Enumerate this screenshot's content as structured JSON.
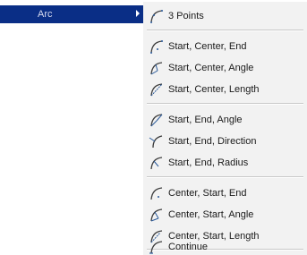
{
  "parent": {
    "label": "Arc"
  },
  "submenu": {
    "groups": [
      {
        "items": [
          {
            "label": "3 Points",
            "icon": "arc-3-points-icon"
          }
        ]
      },
      {
        "items": [
          {
            "label": "Start, Center, End",
            "icon": "arc-start-center-end-icon"
          },
          {
            "label": "Start, Center, Angle",
            "icon": "arc-start-center-angle-icon"
          },
          {
            "label": "Start, Center, Length",
            "icon": "arc-start-center-length-icon"
          }
        ]
      },
      {
        "items": [
          {
            "label": "Start, End, Angle",
            "icon": "arc-start-end-angle-icon"
          },
          {
            "label": "Start, End, Direction",
            "icon": "arc-start-end-direction-icon"
          },
          {
            "label": "Start, End, Radius",
            "icon": "arc-start-end-radius-icon"
          }
        ]
      },
      {
        "items": [
          {
            "label": "Center, Start, End",
            "icon": "arc-center-start-end-icon"
          },
          {
            "label": "Center, Start, Angle",
            "icon": "arc-center-start-angle-icon"
          },
          {
            "label": "Center, Start, Length",
            "icon": "arc-center-start-length-icon"
          }
        ]
      },
      {
        "items": [
          {
            "label": "Continue",
            "icon": "arc-continue-icon"
          }
        ]
      }
    ]
  },
  "colors": {
    "highlight": "#0a2e86",
    "menu_bg": "#f2f2f2",
    "icon_stroke": "#3a3a3a",
    "icon_accent": "#2a5a9a"
  }
}
